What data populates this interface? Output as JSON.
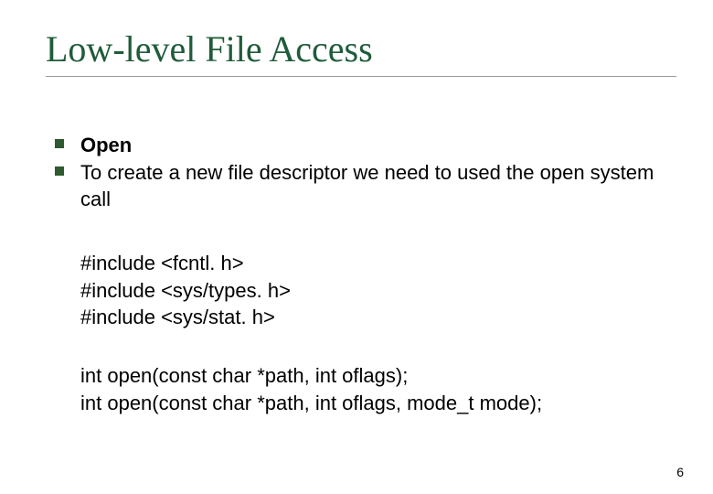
{
  "title": "Low-level File Access",
  "bullets": [
    {
      "text": "Open",
      "bold": true
    },
    {
      "text": "To create a new file descriptor we need to used the open system call",
      "bold": false
    }
  ],
  "code": {
    "includes": [
      "#include <fcntl. h>",
      "#include <sys/types. h>",
      "#include <sys/stat. h>"
    ],
    "prototypes": [
      "int open(const char *path, int oflags);",
      "int open(const char *path, int oflags, mode_t mode);"
    ]
  },
  "page_number": "6"
}
